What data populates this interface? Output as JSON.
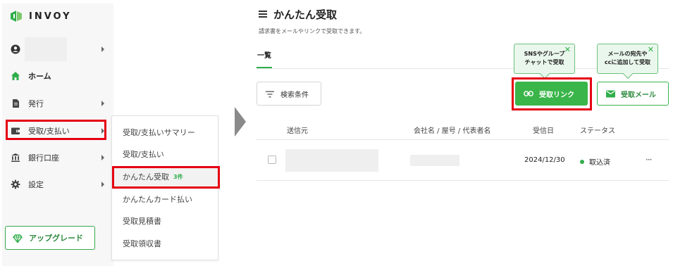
{
  "colors": {
    "accent": "#3ab54a",
    "highlight": "#e60012",
    "sidebar_bg": "#f7f7f7"
  },
  "sidebar": {
    "logo_text": "INVOY",
    "items": [
      {
        "label": "",
        "icon": "account-circle-icon"
      },
      {
        "label": "ホーム",
        "icon": "home-icon"
      },
      {
        "label": "発行",
        "icon": "document-icon"
      },
      {
        "label": "受取/支払い",
        "icon": "wallet-icon"
      },
      {
        "label": "銀行口座",
        "icon": "bank-icon"
      },
      {
        "label": "設定",
        "icon": "gear-icon"
      }
    ],
    "upgrade_label": "アップグレード"
  },
  "submenu": {
    "items": [
      {
        "label": "受取/支払いサマリー"
      },
      {
        "label": "受取/支払い"
      },
      {
        "label": "かんたん受取",
        "badge": "3件"
      },
      {
        "label": "かんたんカード払い"
      },
      {
        "label": "受取見積書"
      },
      {
        "label": "受取領収書"
      }
    ]
  },
  "main": {
    "title": "かんたん受取",
    "description": "請求書をメールやリンクで受取できます。",
    "tab_label": "一覧",
    "tooltip_link": {
      "line1": "SNSやグループ",
      "line2": "チャットで受取"
    },
    "tooltip_mail": {
      "line1": "メールの宛先や",
      "line2": "ccに追加して受取"
    },
    "filter_label": "検索条件",
    "link_button_label": "受取リンク",
    "mail_button_label": "受取メール",
    "table": {
      "headers": [
        "送信元",
        "会社名 / 屋号 / 代表者名",
        "受信日",
        "ステータス"
      ],
      "rows": [
        {
          "date": "2024/12/30",
          "status": "取込済",
          "more": "···"
        }
      ]
    }
  }
}
